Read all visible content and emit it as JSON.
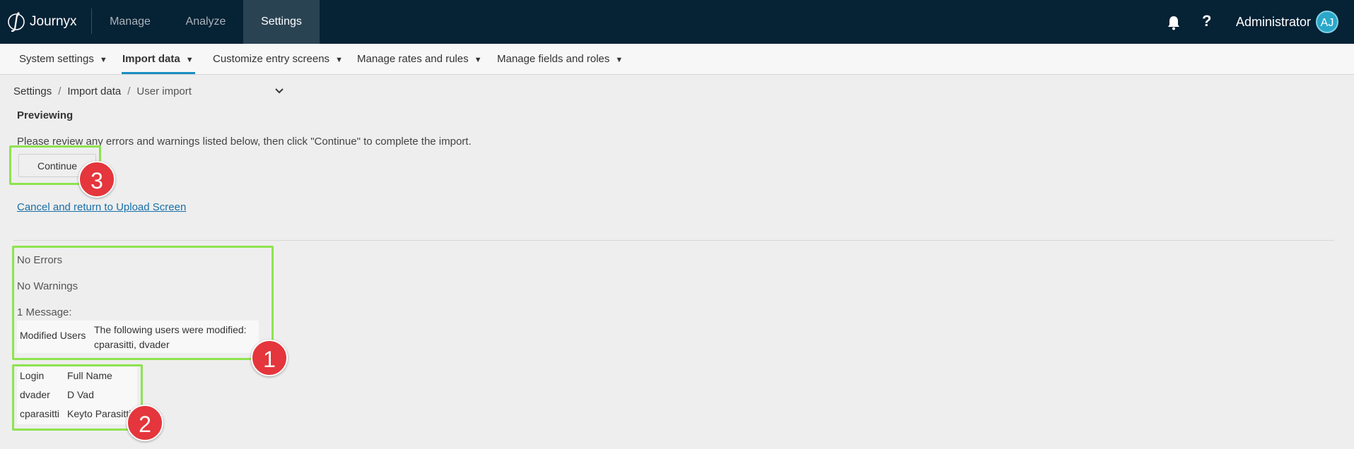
{
  "app": {
    "name": "Journyx"
  },
  "topnav": {
    "items": [
      {
        "label": "Manage"
      },
      {
        "label": "Analyze"
      },
      {
        "label": "Settings",
        "active": true
      }
    ]
  },
  "user": {
    "name": "Administrator",
    "initials": "AJ"
  },
  "subnav": {
    "items": [
      {
        "label": "System settings"
      },
      {
        "label": "Import data",
        "active": true
      },
      {
        "label": "Customize entry screens"
      },
      {
        "label": "Manage rates and rules"
      },
      {
        "label": "Manage fields and roles"
      }
    ]
  },
  "breadcrumb": {
    "items": [
      "Settings",
      "Import data",
      "User import"
    ]
  },
  "page": {
    "section_title": "Previewing",
    "instructions": "Please review any errors and warnings listed below, then click \"Continue\" to complete the import.",
    "continue_label": "Continue",
    "cancel_link": "Cancel and return to Upload Screen"
  },
  "results": {
    "errors": "No Errors",
    "warnings": "No Warnings",
    "messages_count": "1 Message:",
    "messages": [
      {
        "key": "Modified Users",
        "line1": "The following users were modified:",
        "line2": "cparasitti, dvader"
      }
    ]
  },
  "users_table": {
    "headers": [
      "Login",
      "Full Name"
    ],
    "rows": [
      [
        "dvader",
        "D Vad"
      ],
      [
        "cparasitti",
        "Keyto Parasitti"
      ]
    ]
  },
  "annotations": [
    "1",
    "2",
    "3"
  ],
  "colors": {
    "topbar": "#062235",
    "accent": "#1b8ec2",
    "highlight": "#8ee34f",
    "badge": "#e4363c"
  }
}
